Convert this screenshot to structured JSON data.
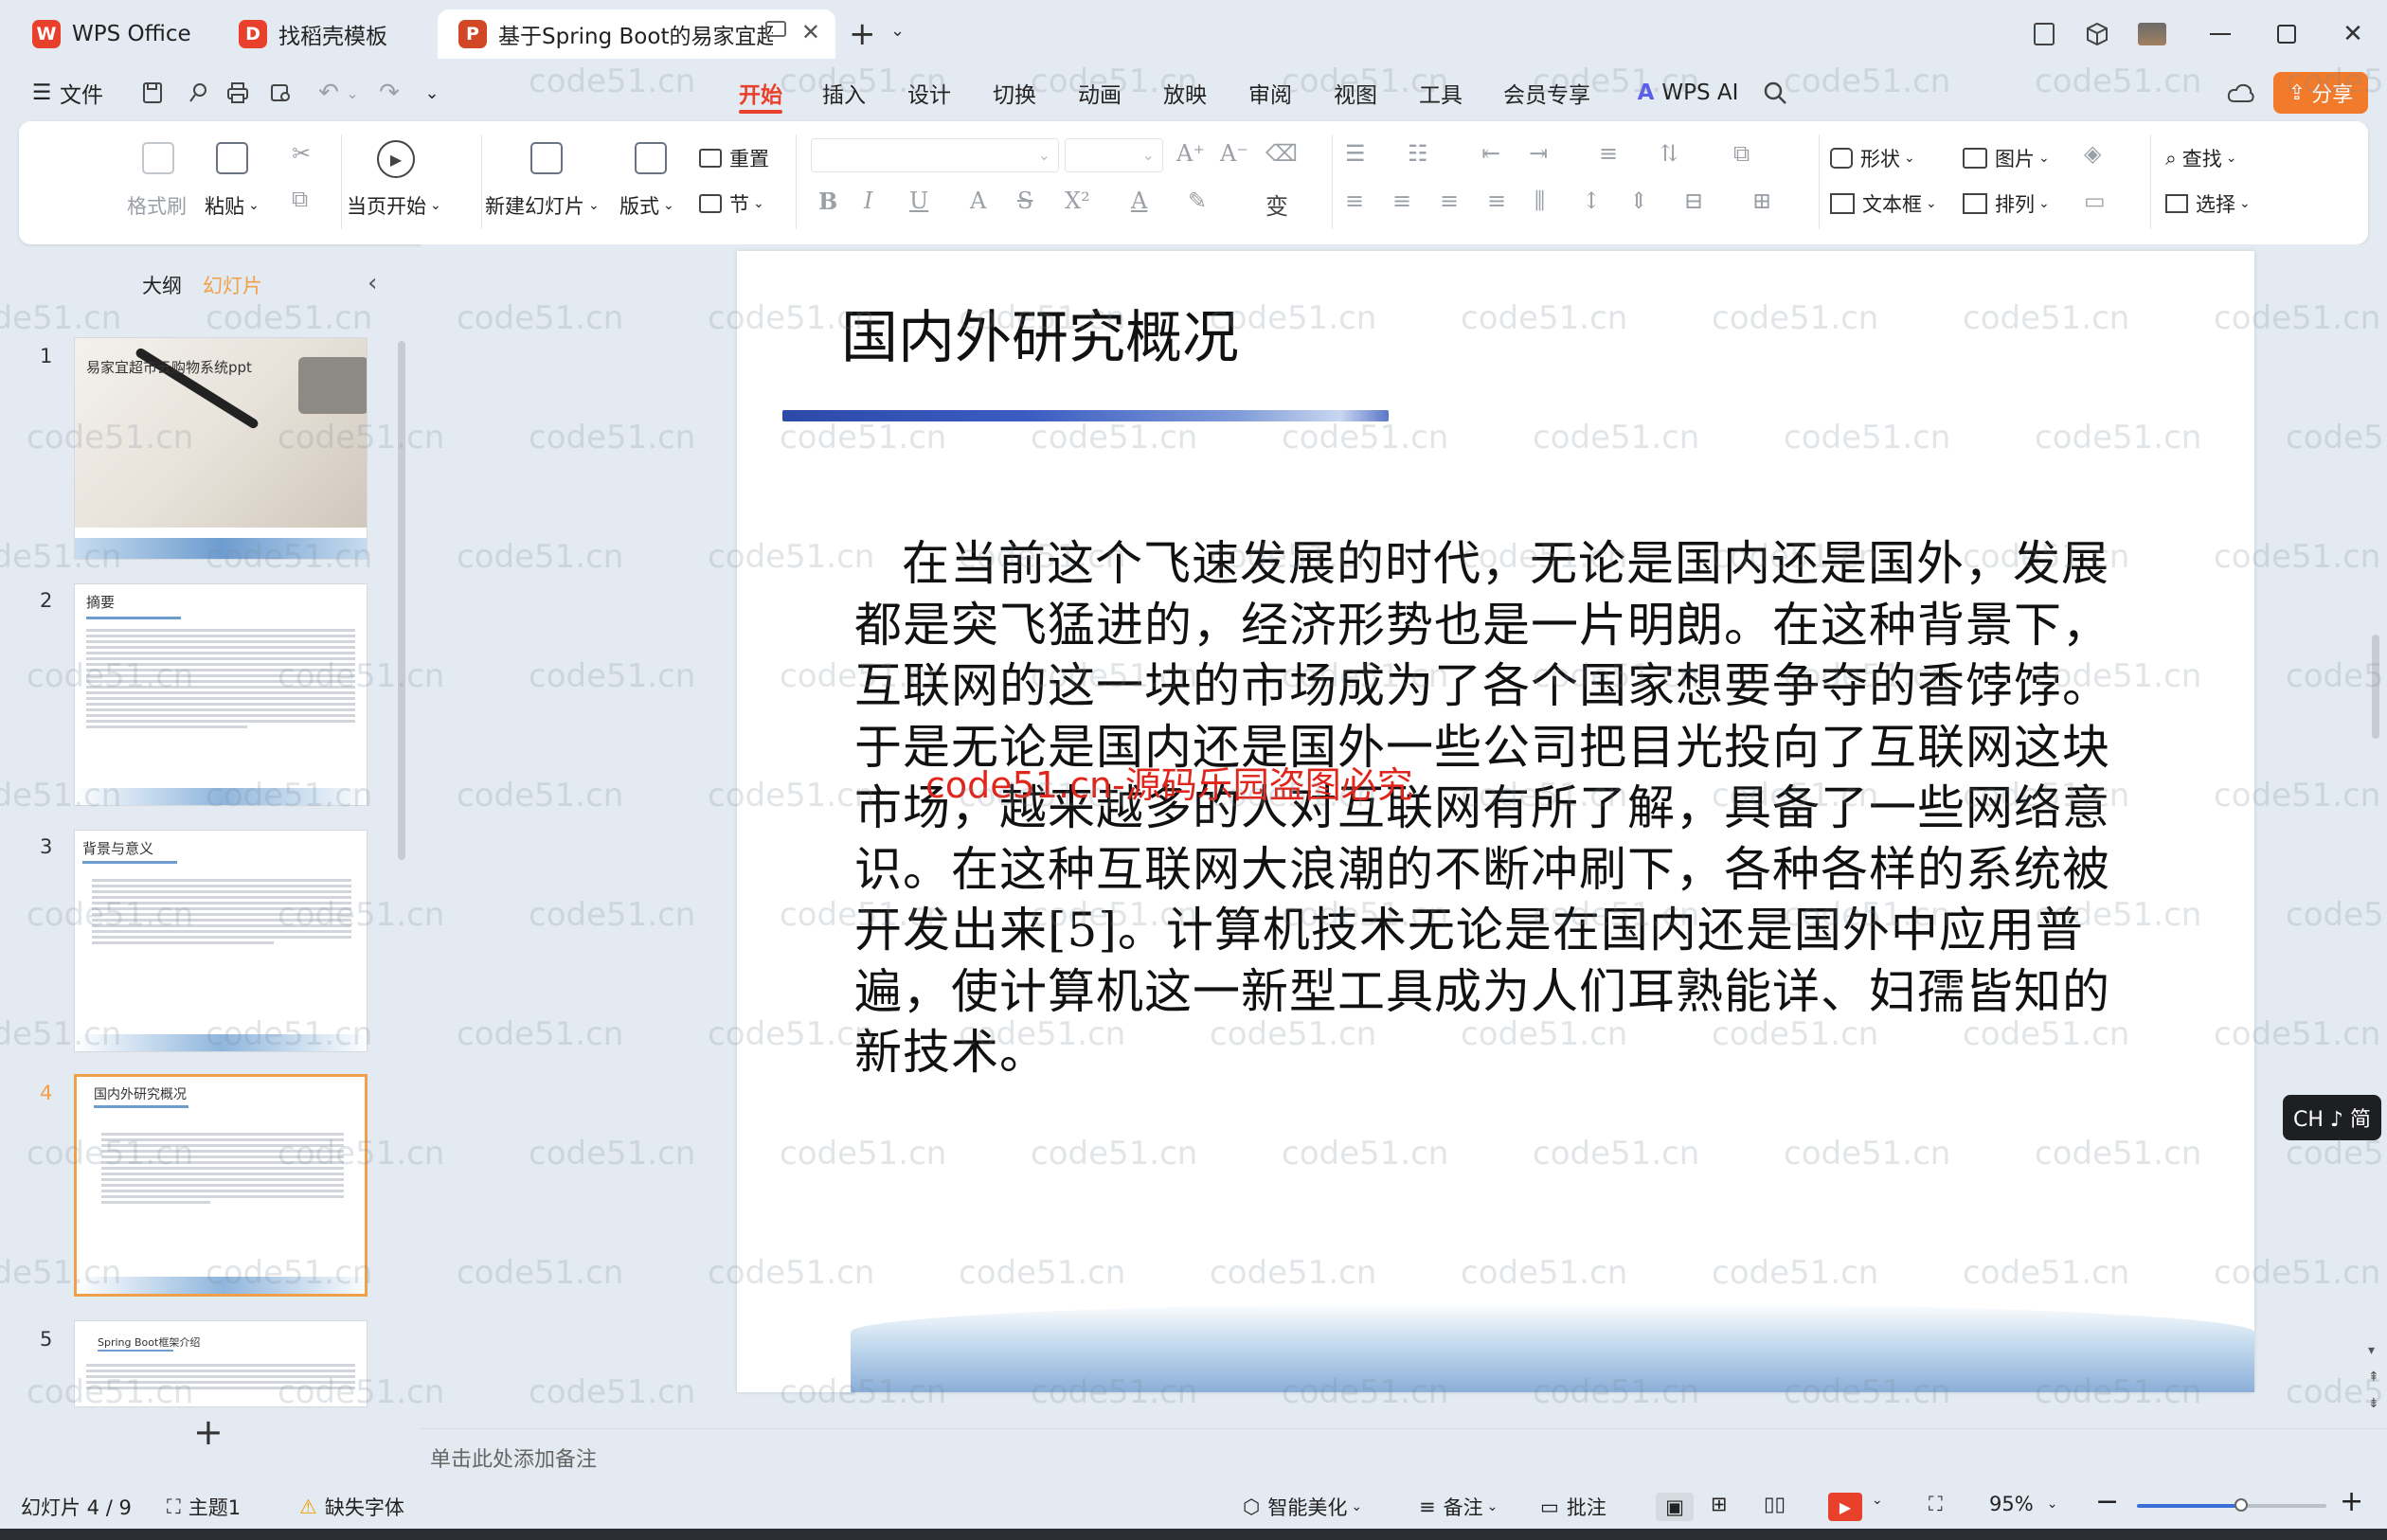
{
  "tabs": [
    {
      "label": "WPS Office",
      "icon": "wps-logo-icon",
      "color": "#e8402a"
    },
    {
      "label": "找稻壳模板",
      "icon": "docer-icon",
      "color": "#e8402a"
    },
    {
      "label": "基于Spring Boot的易家宜超市",
      "icon": "presentation-icon",
      "color": "#d24726"
    }
  ],
  "menu": {
    "file": "文件",
    "items": [
      "开始",
      "插入",
      "设计",
      "切换",
      "动画",
      "放映",
      "审阅",
      "视图",
      "工具",
      "会员专享"
    ],
    "active": "开始",
    "wps_ai": "WPS AI",
    "share": "分享"
  },
  "ribbon": {
    "format_painter": "格式刷",
    "paste": "粘贴",
    "play_from_current": "当页开始",
    "new_slide": "新建幻灯片",
    "layout": "版式",
    "reset": "重置",
    "section": "节",
    "shape": "形状",
    "picture": "图片",
    "textbox": "文本框",
    "arrange": "排列",
    "find": "查找",
    "select": "选择"
  },
  "left_panel": {
    "tab_outline": "大纲",
    "tab_slides": "幻灯片",
    "thumbs": [
      {
        "num": "1",
        "title": "易家宜超市云购物系统ppt"
      },
      {
        "num": "2",
        "title": "摘要"
      },
      {
        "num": "3",
        "title": "背景与意义"
      },
      {
        "num": "4",
        "title": "国内外研究概况"
      },
      {
        "num": "5",
        "title": "Spring Boot框架介绍"
      }
    ],
    "add": "+"
  },
  "slide": {
    "title": "国内外研究概况",
    "body": "在当前这个飞速发展的时代，无论是国内还是国外，发展都是突飞猛进的，经济形势也是一片明朗。在这种背景下，互联网的这一块的市场成为了各个国家想要争夺的香饽饽。于是无论是国内还是国外一些公司把目光投向了互联网这块市场，越来越多的人对互联网有所了解，具备了一些网络意识。在这种互联网大浪潮的不断冲刷下，各种各样的系统被开发出来[5]。计算机技术无论是在国内还是国外中应用普遍，使计算机这一新型工具成为人们耳熟能详、妇孺皆知的新技术。",
    "red_watermark": "code51.cn-源码乐园盗图必究"
  },
  "watermark_text": "code51.cn",
  "notes_placeholder": "单击此处添加备注",
  "ime_badge": "CH ♪ 简",
  "status": {
    "slide_count": "幻灯片 4 / 9",
    "theme": "主题1",
    "missing_font": "缺失字体",
    "smart_beautify": "智能美化",
    "notes": "备注",
    "comments": "批注",
    "zoom": "95%",
    "zoom_level": 0.55
  },
  "colors": {
    "accent": "#e8402a",
    "selection": "#f0a04b",
    "share_button": "#f27a2b"
  }
}
